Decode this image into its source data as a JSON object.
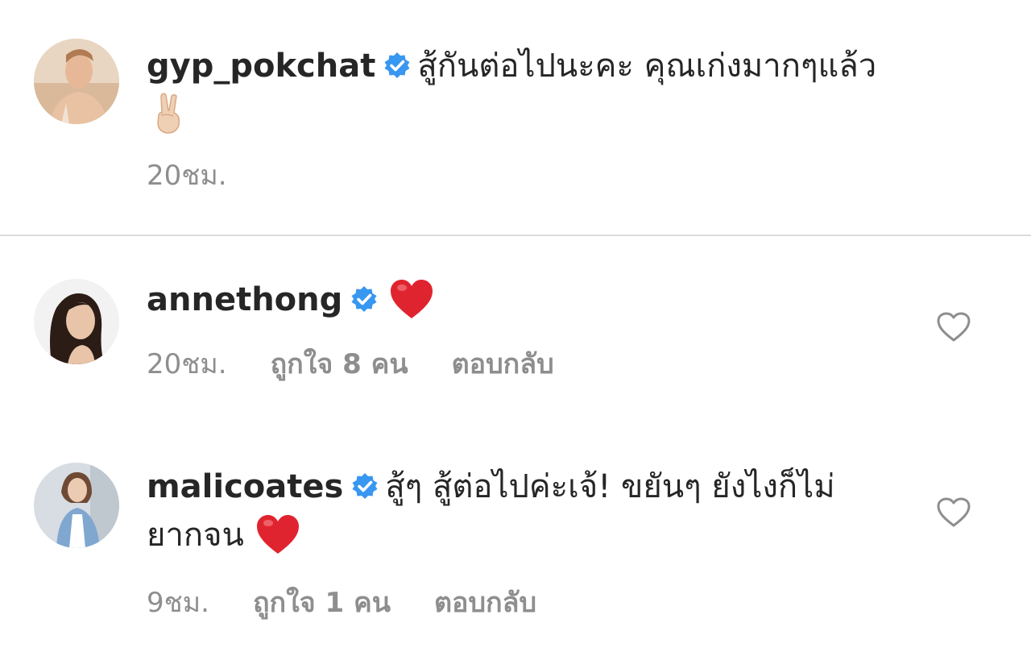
{
  "comments": [
    {
      "username": "gyp_pokchat",
      "text": "สู้กันต่อไปนะคะ คุณเก่งมากๆแล้ว",
      "emoji": "victory-hand-emoji",
      "time": "20ชม.",
      "likes": "",
      "reply_label": "",
      "verified": true
    },
    {
      "username": "annethong",
      "text": "",
      "emoji": "red-heart-emoji",
      "time": "20ชม.",
      "likes": "ถูกใจ 8 คน",
      "reply_label": "ตอบกลับ",
      "verified": true
    },
    {
      "username": "malicoates",
      "text": "สู้ๆ สู้ต่อไปค่ะเจ้! ขยันๆ ยังไงก็ไม่ยากจน",
      "emoji": "red-heart-emoji",
      "time": "9ชม.",
      "likes": "ถูกใจ 1 คน",
      "reply_label": "ตอบกลับ",
      "verified": true
    }
  ],
  "colors": {
    "text": "#262626",
    "secondary": "#8e8e8e",
    "verified": "#3897f0",
    "divider": "#dbdbdb",
    "heart": "#e0242f"
  }
}
